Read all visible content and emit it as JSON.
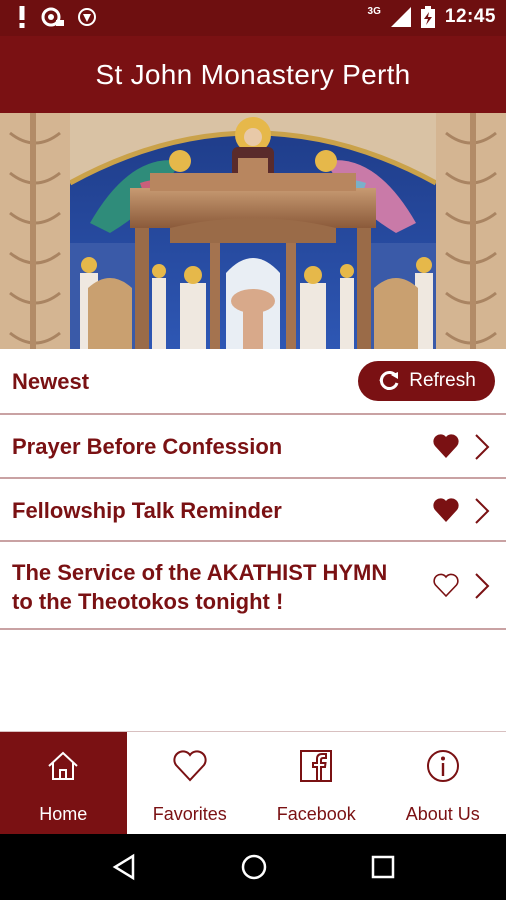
{
  "status_bar": {
    "time": "12:45",
    "network": "3G",
    "icons": [
      "alert-icon",
      "sync-icon",
      "shield-icon",
      "signal-icon",
      "battery-icon"
    ]
  },
  "app_bar": {
    "title": "St John Monastery Perth"
  },
  "hero": {
    "image": "monastery-iconostasis-photo"
  },
  "section": {
    "label": "Newest",
    "refresh_label": "Refresh"
  },
  "items": [
    {
      "title": "Prayer Before Confession",
      "favorited": true
    },
    {
      "title": "Fellowship Talk Reminder",
      "favorited": true
    },
    {
      "title_line1": "The Service of the AKATHIST HYMN",
      "title_line2": "to the Theotokos  tonight !",
      "favorited": false
    }
  ],
  "bottom_nav": {
    "tabs": [
      {
        "label": "Home",
        "icon": "home-icon",
        "active": true
      },
      {
        "label": "Favorites",
        "icon": "heart-icon",
        "active": false
      },
      {
        "label": "Facebook",
        "icon": "facebook-icon",
        "active": false
      },
      {
        "label": "About Us",
        "icon": "info-icon",
        "active": false
      }
    ]
  },
  "colors": {
    "primary": "#7a1113",
    "status": "#6e0f10",
    "divider": "#c9a2a3"
  }
}
